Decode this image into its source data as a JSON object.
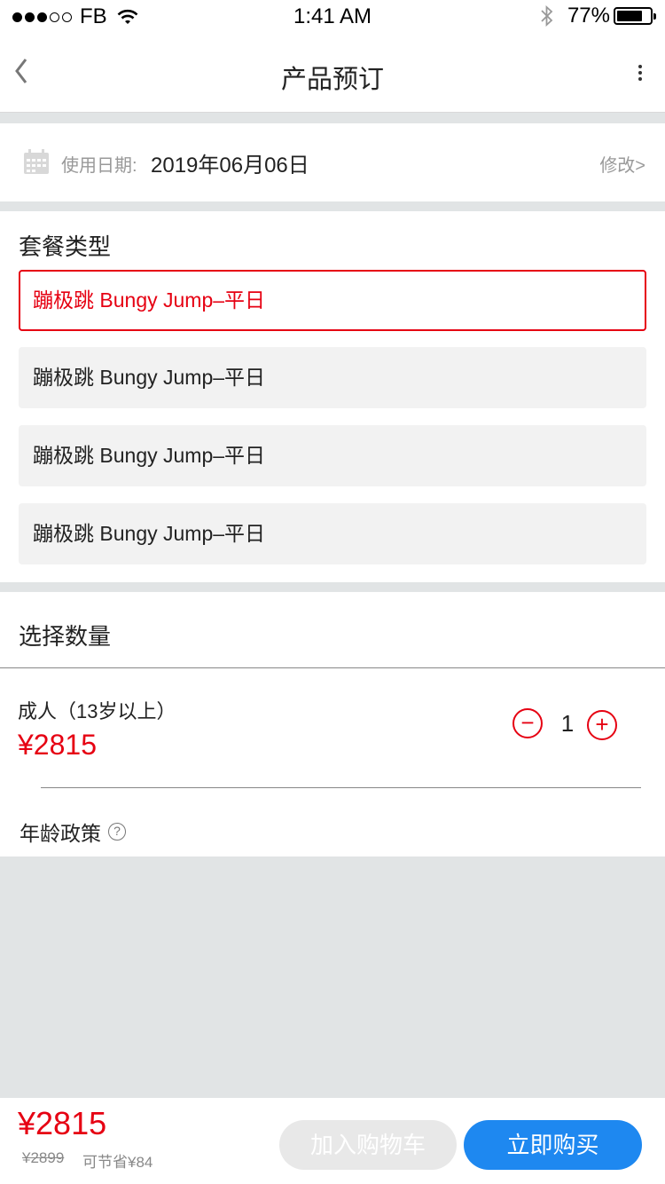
{
  "status_bar": {
    "carrier": "FB",
    "time": "1:41 AM",
    "battery_text": "77%",
    "battery_level": 0.77
  },
  "nav": {
    "title": "产品预订"
  },
  "date": {
    "label": "使用日期:",
    "value": "2019年06月06日",
    "modify_label": "修改>"
  },
  "package": {
    "title": "套餐类型",
    "options": [
      {
        "label": "蹦极跳 Bungy Jump–平日",
        "selected": true
      },
      {
        "label": "蹦极跳 Bungy Jump–平日",
        "selected": false
      },
      {
        "label": "蹦极跳 Bungy Jump–平日",
        "selected": false
      },
      {
        "label": "蹦极跳 Bungy Jump–平日",
        "selected": false
      }
    ]
  },
  "quantity": {
    "title": "选择数量",
    "adult_label": "成人（13岁以上）",
    "adult_price": "¥2815",
    "count": "1",
    "minus_symbol": "−",
    "plus_symbol": "+",
    "age_policy_label": "年龄政策",
    "help_symbol": "?"
  },
  "bottom": {
    "total_price": "¥2815",
    "original_price": "¥2899",
    "save_text": "可节省¥84",
    "cart_label": "加入购物车",
    "buy_label": "立即购买"
  },
  "colors": {
    "accent_red": "#e60012",
    "buy_blue": "#1e88f0",
    "background_gray": "#e1e4e5"
  }
}
